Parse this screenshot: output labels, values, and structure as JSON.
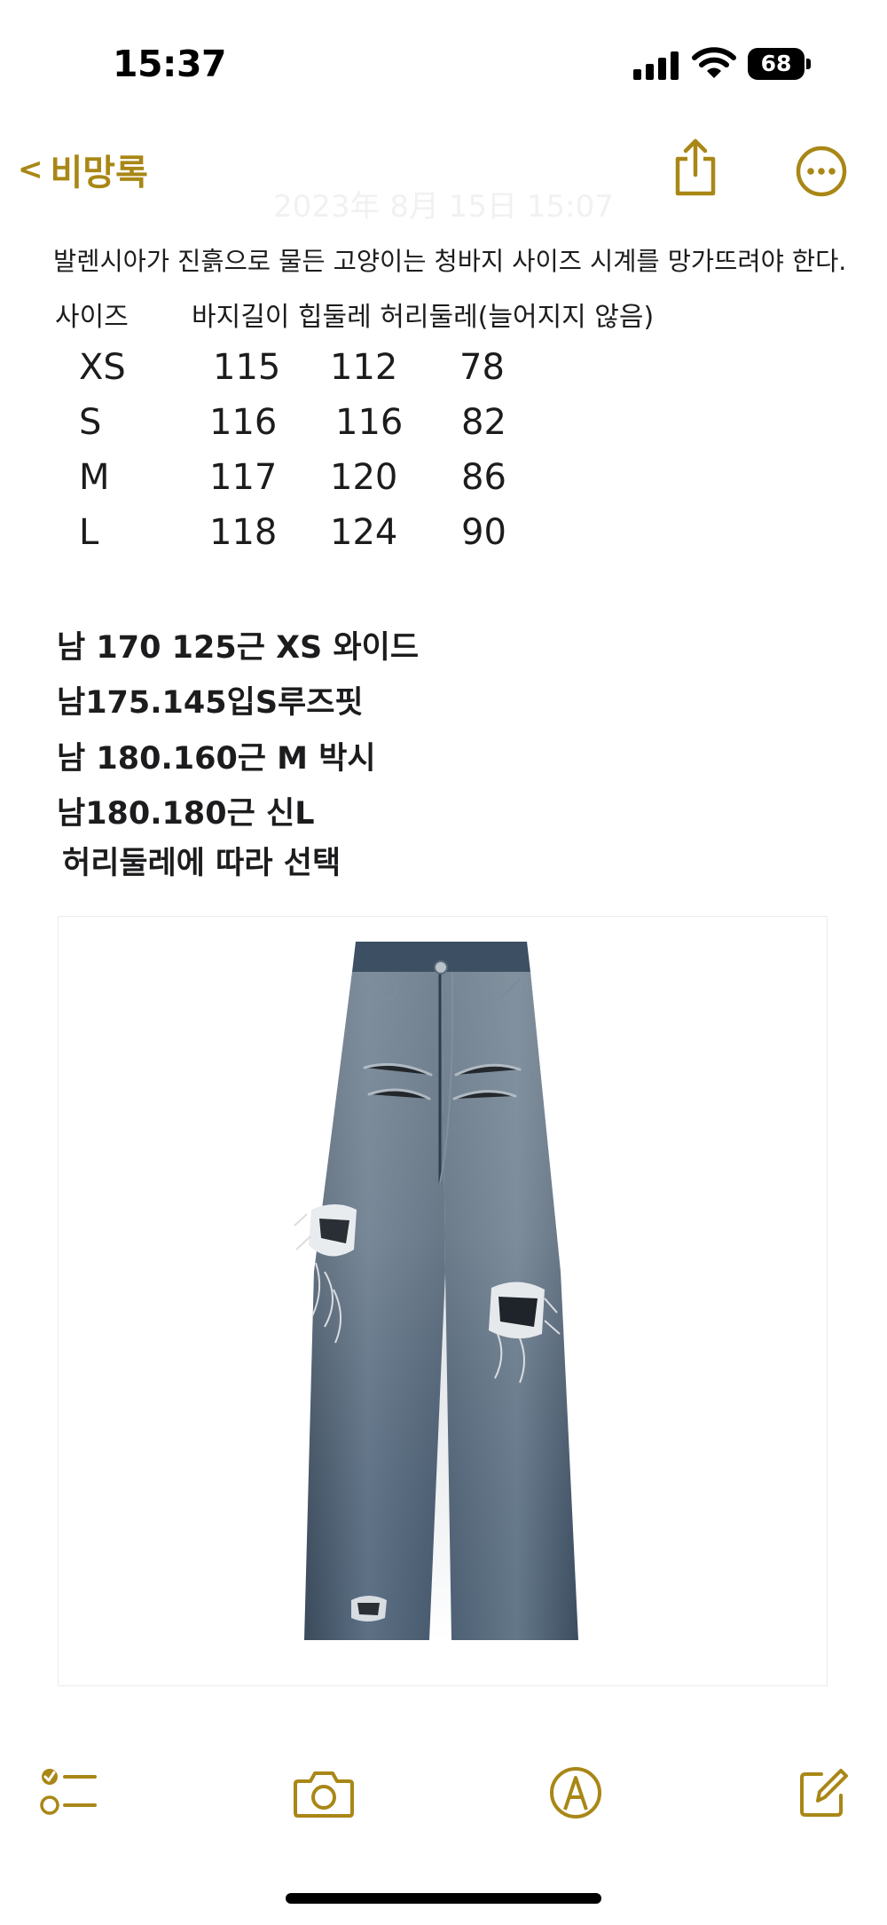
{
  "status_bar": {
    "time": "15:37",
    "battery": "68"
  },
  "nav": {
    "back_label": "비망록",
    "back_chevron": "<"
  },
  "header": {
    "date_faint": "2023年 8月 15日 15:07"
  },
  "note": {
    "intro": "발렌시아가 진흙으로 물든 고양이는 청바지 사이즈 시계를 망가뜨려야 한다.",
    "header_size": "사이즈",
    "header_columns": "바지길이 힙둘레 허리둘레(늘어지지 않음)",
    "size_rows": [
      {
        "size": "XS",
        "length": "115",
        "hip": "112",
        "waist": "78"
      },
      {
        "size": "S",
        "length": "116",
        "hip": "116",
        "waist": "82"
      },
      {
        "size": "M",
        "length": "117",
        "hip": "120",
        "waist": "86"
      },
      {
        "size": "L",
        "length": "118",
        "hip": "124",
        "waist": "90"
      }
    ],
    "recommendations": [
      "남 170 125근 XS 와이드",
      "남175.145입S루즈핏",
      "남 180.160근 M 박시",
      "남180.180근 신L"
    ],
    "choose_by": "허리둘레에 따라 선택"
  },
  "colors": {
    "accent": "#a98716",
    "text": "#1c1c1e",
    "denim": "#4a5d70"
  },
  "icons": {
    "share": "share-icon",
    "more": "more-icon",
    "checklist": "checklist-icon",
    "camera": "camera-icon",
    "markup": "markup-pen-icon",
    "compose": "compose-icon"
  }
}
